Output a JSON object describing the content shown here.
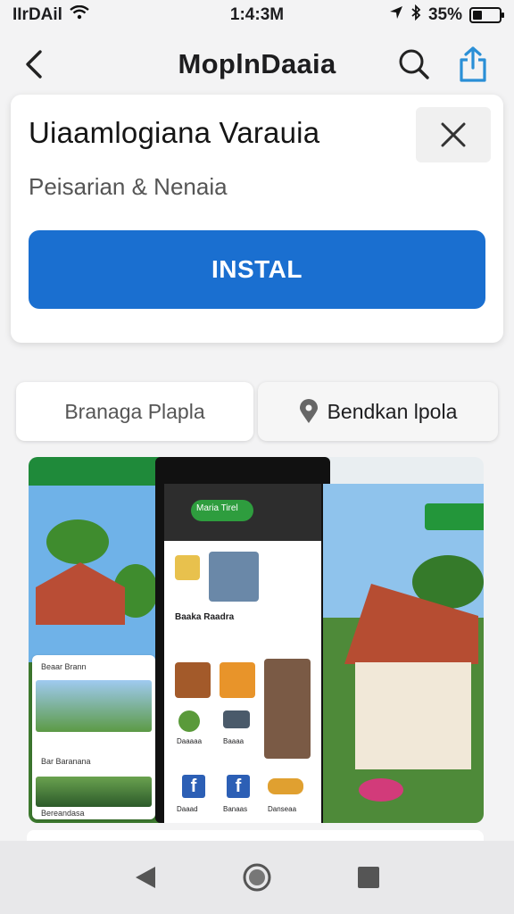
{
  "status": {
    "carrier": "IIrDAil",
    "time": "1:4:3M",
    "battery_text": "35%",
    "battery_level": 0.35
  },
  "header": {
    "title": "MoplnDaaia"
  },
  "install_card": {
    "app_name": "Uiaamlogiana Varauia",
    "developer": "Peisarian & Nenaia",
    "install_label": "INSTAL"
  },
  "chips": {
    "left_label": "Branaga Plapla",
    "right_label": "Bendkan lpola"
  },
  "gallery": {
    "left_tiles": [
      "Beaar Brann",
      "Bar Baranana",
      "Bereandasa"
    ],
    "mid_header": "Maria Tirel",
    "mid_caption": "Baaka Raadra",
    "mid_items": [
      "Daaaaa",
      "Baaaa",
      "Daaad",
      "Banaas",
      "Danseaa"
    ]
  },
  "icons": {
    "back": "chevron-left-icon",
    "search": "search-icon",
    "share": "share-icon",
    "close": "close-icon",
    "location": "location-pin-icon"
  },
  "colors": {
    "accent": "#1a6fd0",
    "brand_green": "#2e9d3e",
    "share_blue": "#2a8fd6"
  }
}
